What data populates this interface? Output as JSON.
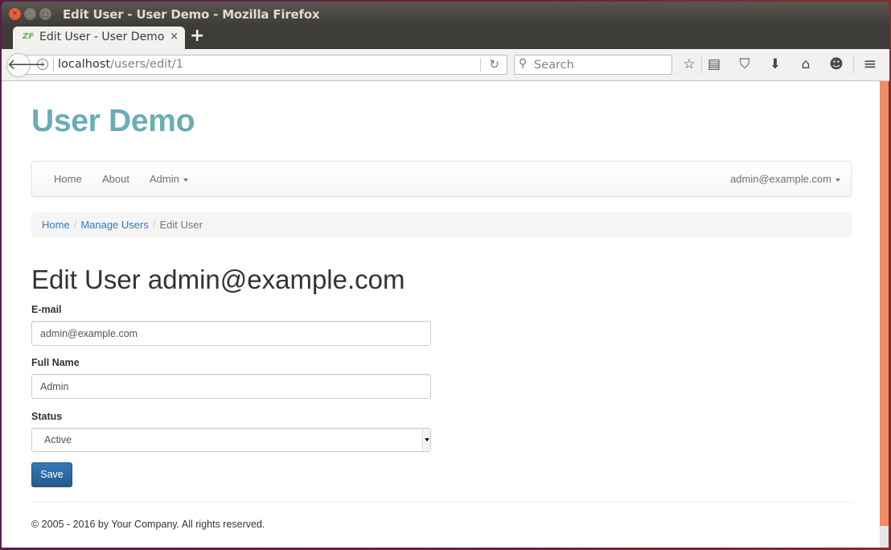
{
  "window": {
    "title": "Edit User - User Demo - Mozilla Firefox",
    "controls": {
      "close": "×",
      "minimize": "–",
      "maximize": "□"
    }
  },
  "browser": {
    "tab": {
      "favicon": "ZF",
      "title": "Edit User - User Demo",
      "close": "×"
    },
    "new_tab": "+",
    "url": {
      "host": "localhost",
      "path": "/users/edit/1"
    },
    "search_placeholder": "Search",
    "icons": {
      "back": "🡐",
      "info": "i",
      "reload": "↻",
      "search": "⚲",
      "bookmark": "☆",
      "reading_list": "▤",
      "pocket": "⛉",
      "downloads": "⬇",
      "home": "⌂",
      "chat": "☻",
      "menu": "≡"
    }
  },
  "site": {
    "brand": "User Demo",
    "brand_color": "#6aadb4",
    "nav": {
      "items": [
        {
          "label": "Home"
        },
        {
          "label": "About"
        },
        {
          "label": "Admin"
        }
      ],
      "user": "admin@example.com"
    },
    "breadcrumb": [
      {
        "label": "Home"
      },
      {
        "label": "Manage Users"
      },
      {
        "label": "Edit User"
      }
    ],
    "breadcrumb_separator": "/",
    "page_title": "Edit User admin@example.com",
    "form": {
      "email_label": "E-mail",
      "email_value": "admin@example.com",
      "fullname_label": "Full Name",
      "fullname_value": "Admin",
      "status_label": "Status",
      "status_value": "Active",
      "save_label": "Save"
    },
    "footer": "© 2005 - 2016 by Your Company. All rights reserved."
  },
  "colors": {
    "link": "#337ab7",
    "primary_button": "#337ab7",
    "scrollbar_thumb": "#ef8c65"
  }
}
